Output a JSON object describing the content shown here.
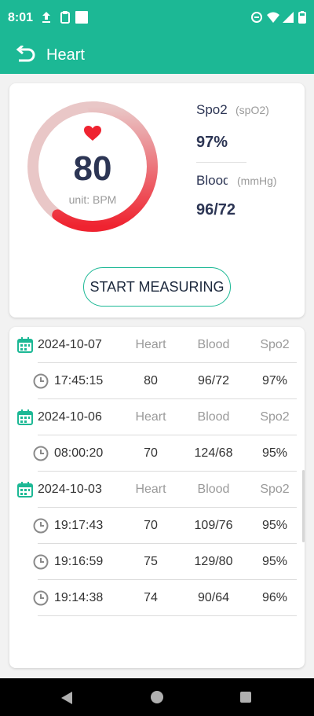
{
  "status_bar": {
    "time": "8:01"
  },
  "app_bar": {
    "title": "Heart"
  },
  "gauge": {
    "value": "80",
    "unit": "unit: BPM",
    "fill_fraction": 0.6,
    "color_start": "#ef2330",
    "color_end": "#e9c7c7"
  },
  "metrics": {
    "spo2": {
      "label": "Spo2",
      "unit": "(spO2)",
      "value": "97%"
    },
    "blood": {
      "label": "Blood",
      "unit": "(mmHg)",
      "value": "96/72"
    }
  },
  "start_button": {
    "label": "START MEASURING"
  },
  "history": {
    "headers": {
      "heart": "Heart",
      "blood": "Blood",
      "spo2": "Spo2"
    },
    "groups": [
      {
        "date": "2024-10-07",
        "records": [
          {
            "time": "17:45:15",
            "heart": "80",
            "blood": "96/72",
            "spo2": "97%"
          }
        ]
      },
      {
        "date": "2024-10-06",
        "records": [
          {
            "time": "08:00:20",
            "heart": "70",
            "blood": "124/68",
            "spo2": "95%"
          }
        ]
      },
      {
        "date": "2024-10-03",
        "records": [
          {
            "time": "19:17:43",
            "heart": "70",
            "blood": "109/76",
            "spo2": "95%"
          },
          {
            "time": "19:16:59",
            "heart": "75",
            "blood": "129/80",
            "spo2": "95%"
          },
          {
            "time": "19:14:38",
            "heart": "74",
            "blood": "90/64",
            "spo2": "96%"
          }
        ]
      }
    ]
  },
  "colors": {
    "primary": "#1cb895",
    "heart_red": "#ef2330",
    "text_dark": "#2c3554"
  }
}
